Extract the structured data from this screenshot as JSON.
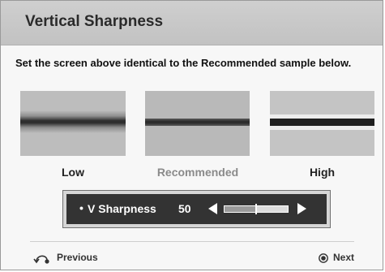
{
  "header": {
    "title": "Vertical Sharpness"
  },
  "instruction": "Set the screen above identical to the Recommended sample  below.",
  "samples": [
    {
      "label": "Low"
    },
    {
      "label": "Recommended"
    },
    {
      "label": "High"
    }
  ],
  "setting": {
    "label": "V Sharpness",
    "value": "50",
    "level": 0.5
  },
  "footer": {
    "previous_label": "Previous",
    "next_label": "Next",
    "previous_icon": "return-arrow-icon",
    "next_icon": "select-button-icon"
  },
  "colors": {
    "header_bg": "#c6c6c6",
    "panel_bg": "#333333",
    "recommended_label": "#8a8a8a"
  }
}
